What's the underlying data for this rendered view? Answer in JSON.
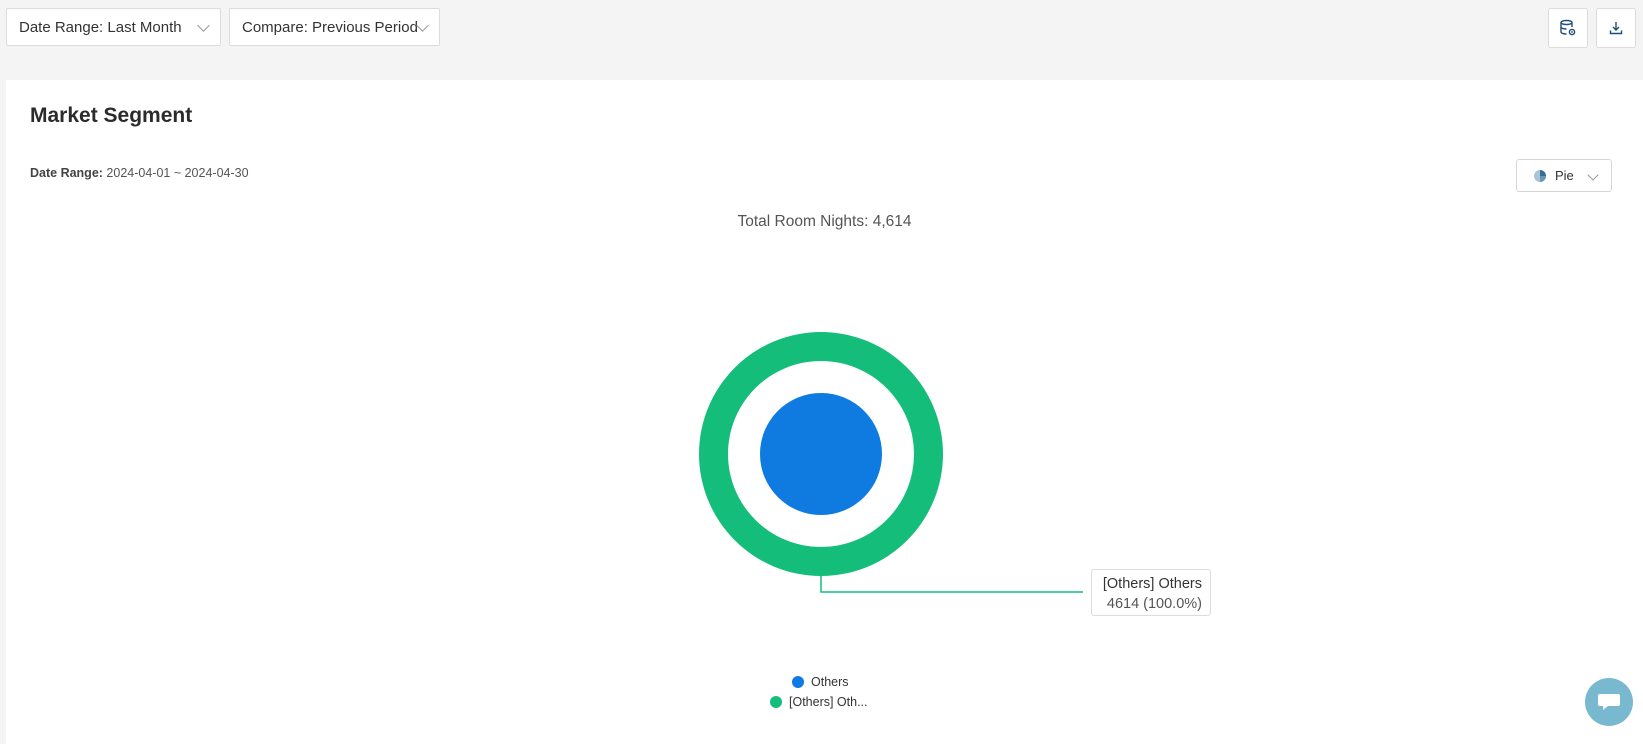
{
  "toolbar": {
    "date_range_label": "Date Range: Last Month",
    "compare_label": "Compare: Previous Period",
    "icons": [
      "database-settings-icon",
      "download-icon"
    ]
  },
  "card": {
    "title": "Market Segment",
    "date_range_key": "Date Range:",
    "date_range_value": "2024-04-01  ~  2024-04-30",
    "chart_type_label": "Pie",
    "chart_type_icon": "pie-chart-icon"
  },
  "chart_data": {
    "type": "pie",
    "title": "Total Room Nights: 4,614",
    "rings": [
      {
        "name": "Others",
        "values": [
          4614
        ],
        "labels": [
          "Others"
        ],
        "color": "#0f7be0"
      },
      {
        "name": "[Others] Others",
        "values": [
          4614
        ],
        "labels": [
          "[Others] Others"
        ],
        "color": "#15bd7b"
      }
    ],
    "tooltip": {
      "label": "[Others] Others",
      "value": "4614 (100.0%)"
    },
    "legend": [
      {
        "label": "Others",
        "color": "#0f7be0"
      },
      {
        "label": "[Others] Oth...",
        "color": "#15bd7b"
      }
    ],
    "legend_placement": "bottom"
  },
  "chat": {
    "icon": "chat-bubble-icon"
  }
}
